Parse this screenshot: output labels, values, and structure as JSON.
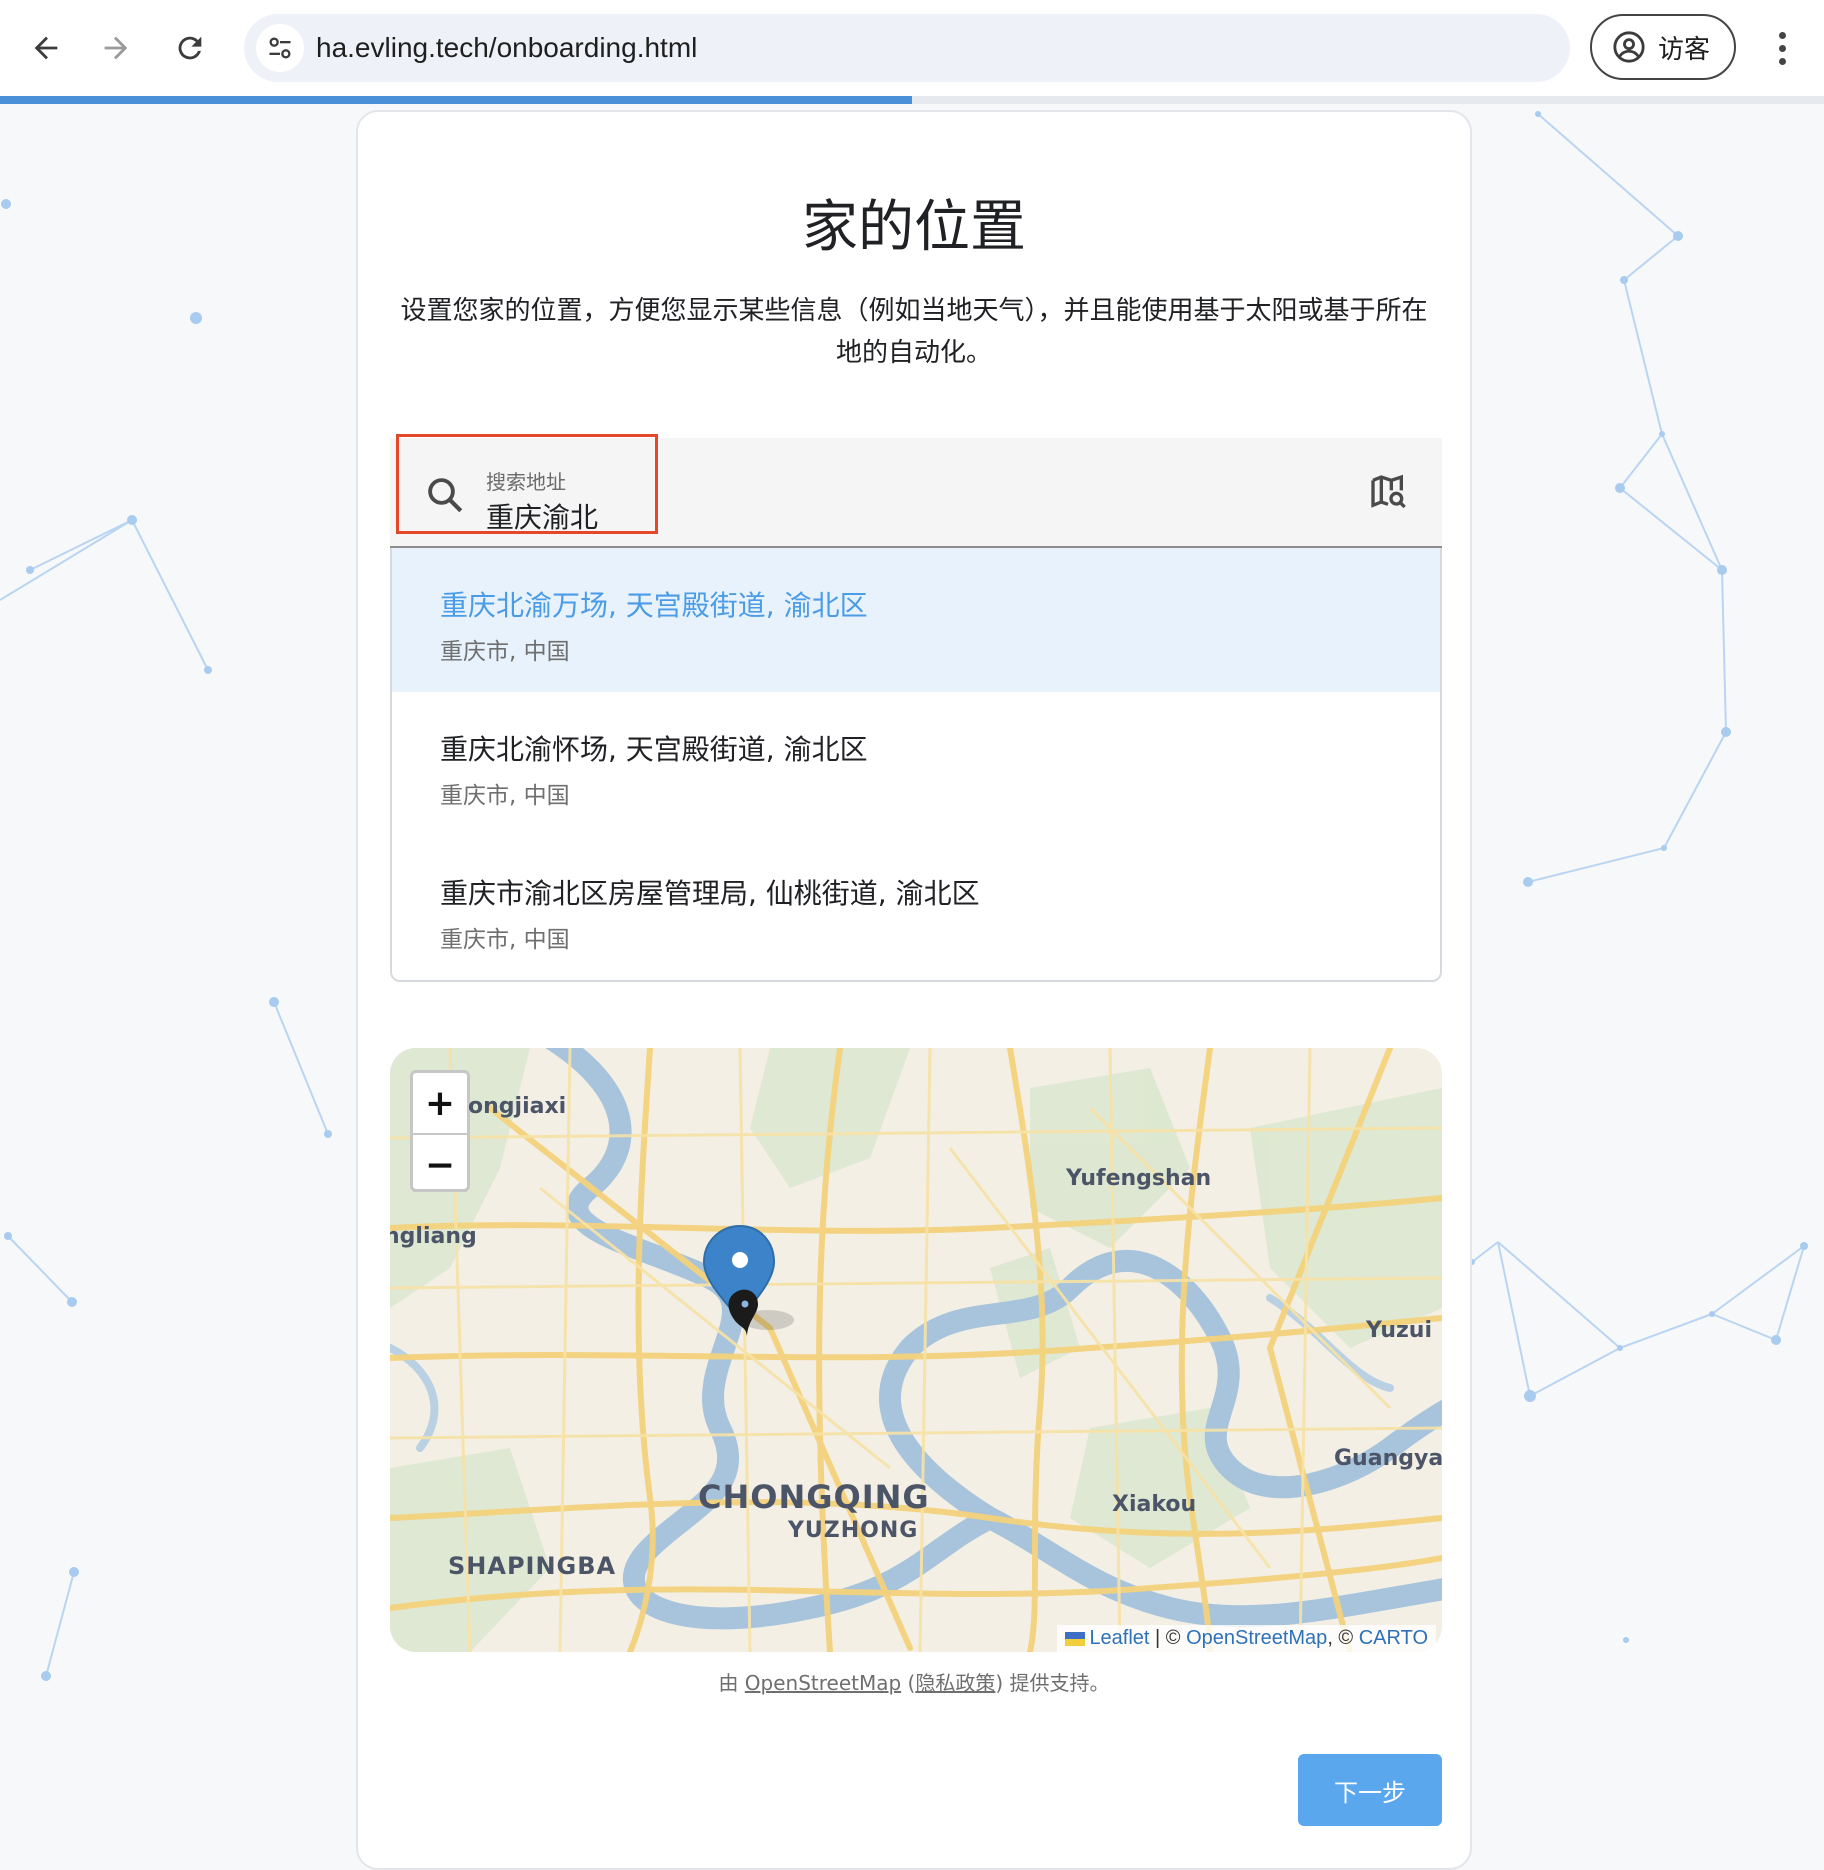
{
  "browser": {
    "url": "ha.evling.tech/onboarding.html",
    "profile_label": "访客",
    "back_icon": "arrow-left-icon",
    "forward_icon": "arrow-right-icon",
    "reload_icon": "reload-icon",
    "menu_icon": "more-vert-icon"
  },
  "progress": {
    "fraction": 0.5
  },
  "onboarding": {
    "title": "家的位置",
    "description": "设置您家的位置，方便您显示某些信息（例如当地天气），并且能使用基于太阳或基于所在地的自动化。",
    "search": {
      "label": "搜索地址",
      "value": "重庆渝北"
    },
    "results": [
      {
        "primary": "重庆北渝万场, 天宫殿街道, 渝北区",
        "secondary": "重庆市, 中国",
        "selected": true
      },
      {
        "primary": "重庆北渝怀场, 天宫殿街道, 渝北区",
        "secondary": "重庆市, 中国",
        "selected": false
      },
      {
        "primary": "重庆市渝北区房屋管理局, 仙桃街道, 渝北区",
        "secondary": "重庆市, 中国",
        "selected": false
      }
    ],
    "map": {
      "zoom_in": "+",
      "zoom_out": "−",
      "place_labels": {
        "l1": "ongjiaxi",
        "l2": "Yufengshan",
        "l3": "ngliang",
        "l4": "Yuzui",
        "l5": "Guangyan",
        "l6": "Xiakou",
        "l7": "CHONGQING",
        "l8": "YUZHONG",
        "l9": "SHAPINGBA"
      },
      "attribution": {
        "leaflet": "Leaflet",
        "sep1": " | © ",
        "osm": "OpenStreetMap",
        "sep2": ", © ",
        "carto": "CARTO"
      }
    },
    "powered_by": {
      "prefix": "由 ",
      "osm": "OpenStreetMap",
      "open_paren": " (",
      "privacy": "隐私政策",
      "suffix": ") 提供支持。"
    },
    "next_button": "下一步"
  },
  "colors": {
    "accent": "#4a9ce6",
    "button": "#5aa7ee",
    "highlight_border": "#e4472a",
    "marker_blue": "#3d83c9"
  }
}
